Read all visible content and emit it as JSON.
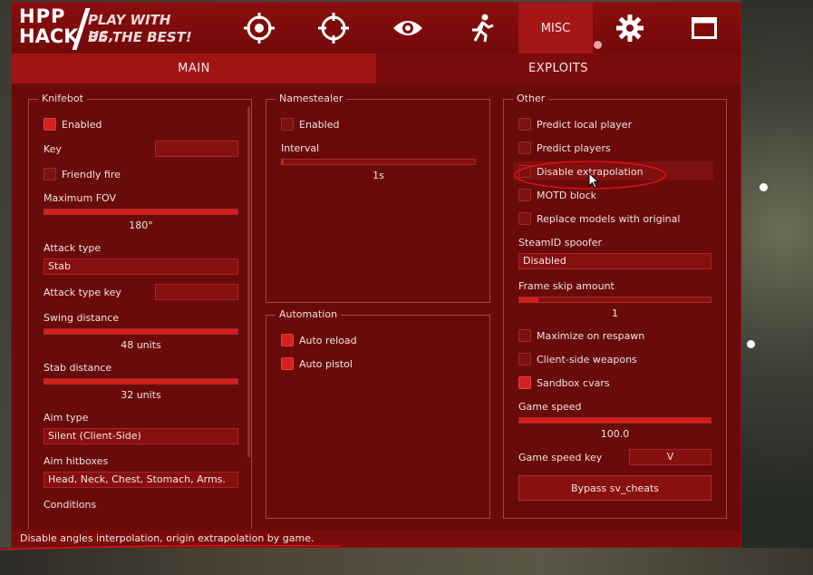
{
  "logo": {
    "top": "HPP",
    "bottom": "HACK",
    "tagline1": "PLAY WITH US,",
    "tagline2": "BE THE BEST!"
  },
  "nav": {
    "tabs": [
      {
        "icon": "target-icon"
      },
      {
        "icon": "crosshair-icon"
      },
      {
        "icon": "eye-icon"
      },
      {
        "icon": "running-man-icon"
      },
      {
        "label": "MISC",
        "active": true
      },
      {
        "icon": "gear-icon"
      },
      {
        "icon": "window-icon"
      }
    ]
  },
  "subtabs": {
    "main": "MAIN",
    "exploits": "EXPLOITS"
  },
  "knifebot": {
    "title": "Knifebot",
    "enabled_label": "Enabled",
    "enabled": true,
    "key_label": "Key",
    "key_value": "",
    "friendly_fire_label": "Friendly fire",
    "friendly_fire": false,
    "max_fov_label": "Maximum FOV",
    "max_fov_value": "180°",
    "max_fov_fraction": 1.0,
    "attack_type_label": "Attack type",
    "attack_type_value": "Stab",
    "attack_type_key_label": "Attack type key",
    "attack_type_key_value": "",
    "swing_distance_label": "Swing distance",
    "swing_distance_value": "48 units",
    "swing_fraction": 1.0,
    "stab_distance_label": "Stab distance",
    "stab_distance_value": "32 units",
    "stab_fraction": 1.0,
    "aim_type_label": "Aim type",
    "aim_type_value": "Silent (Client-Side)",
    "aim_hitboxes_label": "Aim hitboxes",
    "aim_hitboxes_value": "Head, Neck, Chest, Stomach, Arms.",
    "conditions_label": "Conditions"
  },
  "namestealer": {
    "title": "Namestealer",
    "enabled_label": "Enabled",
    "enabled": false,
    "interval_label": "Interval",
    "interval_value": "1s",
    "interval_fraction": 0.01
  },
  "automation": {
    "title": "Automation",
    "auto_reload_label": "Auto reload",
    "auto_reload": true,
    "auto_pistol_label": "Auto pistol",
    "auto_pistol": true
  },
  "other": {
    "title": "Other",
    "predict_local_label": "Predict local player",
    "predict_local": false,
    "predict_players_label": "Predict players",
    "predict_players": false,
    "disable_extrapolation_label": "Disable extrapolation",
    "disable_extrapolation": false,
    "motd_block_label": "MOTD block",
    "motd_block": false,
    "replace_models_label": "Replace models with original",
    "replace_models": false,
    "steamid_spoofer_label": "SteamID spoofer",
    "steamid_spoofer_value": "Disabled",
    "frame_skip_label": "Frame skip amount",
    "frame_skip_value": "1",
    "frame_skip_fraction": 0.1,
    "maximize_respawn_label": "Maximize on respawn",
    "maximize_respawn": false,
    "client_weapons_label": "Client-side weapons",
    "client_weapons": false,
    "sandbox_cvars_label": "Sandbox cvars",
    "sandbox_cvars": true,
    "game_speed_label": "Game speed",
    "game_speed_value": "100.0",
    "game_speed_fraction": 1.0,
    "game_speed_key_label": "Game speed key",
    "game_speed_key_value": "V",
    "bypass_button": "Bypass sv_cheats"
  },
  "status": "Disable angles interpolation, origin extrapolation by game.",
  "colors": {
    "accent": "#d41e1e",
    "panel": "#6a0b0b",
    "annotation": "#e01010"
  }
}
